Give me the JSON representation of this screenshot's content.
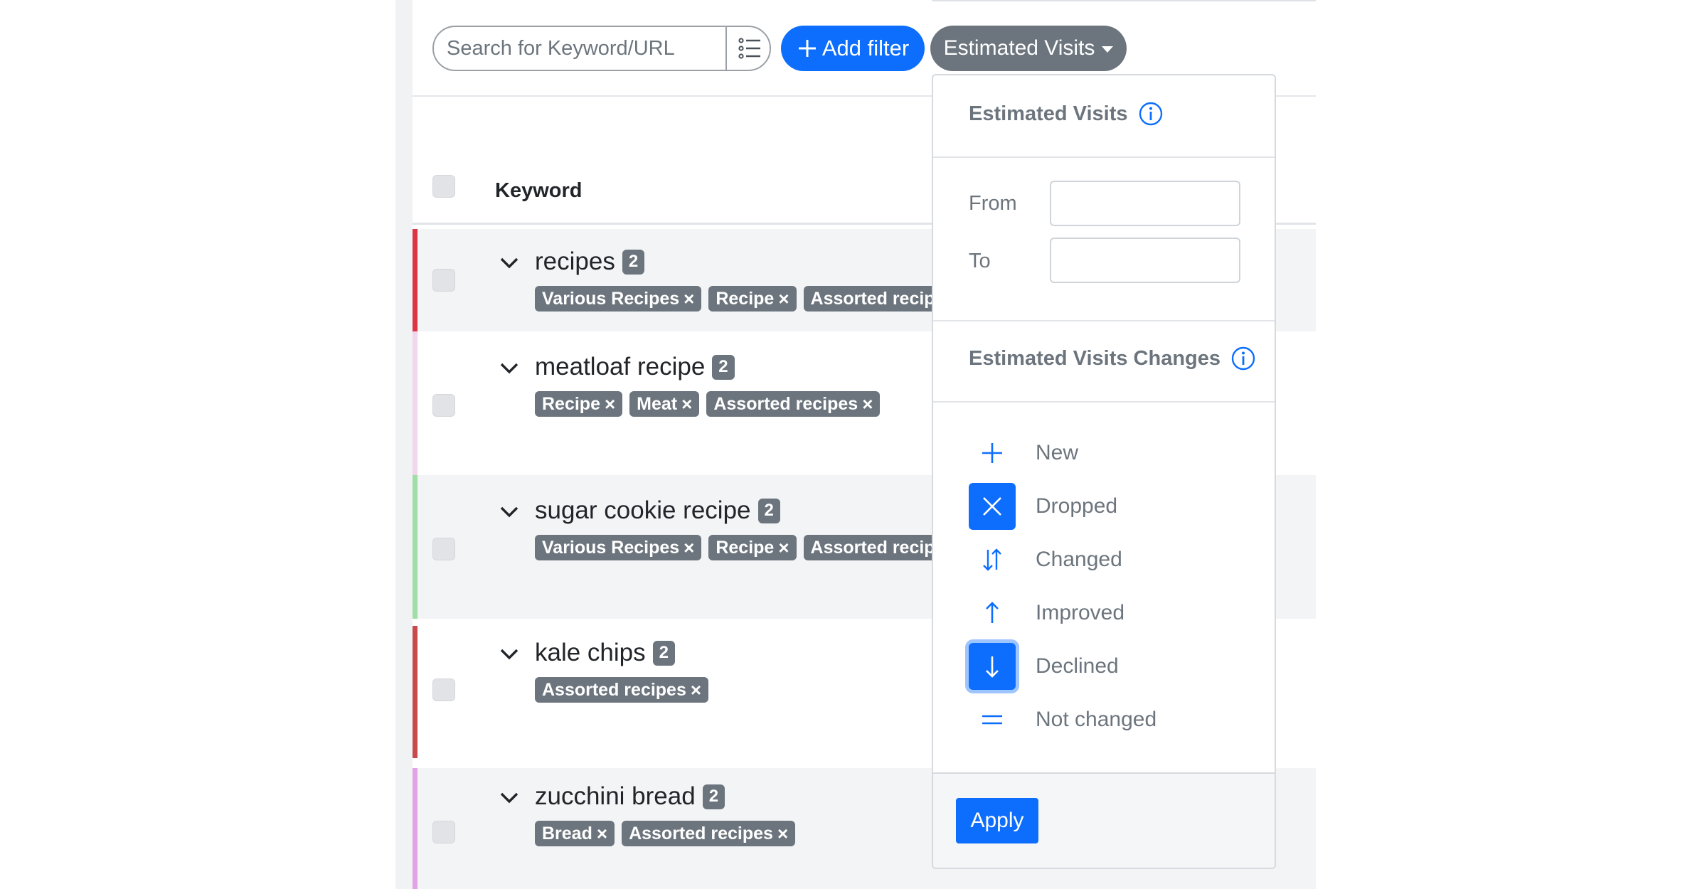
{
  "search": {
    "placeholder": "Search for Keyword/URL",
    "value": ""
  },
  "toolbar": {
    "add_filter_label": "Add filter",
    "estimated_visits_label": "Estimated Visits"
  },
  "table": {
    "header": {
      "keyword_label": "Keyword"
    },
    "rows": [
      {
        "keyword": "recipes",
        "count": "2",
        "stripe_color": "#dc3545",
        "tags": [
          "Various Recipes",
          "Recipe",
          "Assorted recipes"
        ]
      },
      {
        "keyword": "meatloaf recipe",
        "count": "2",
        "stripe_color": "#f1d6ec",
        "tags": [
          "Recipe",
          "Meat",
          "Assorted recipes"
        ]
      },
      {
        "keyword": "sugar cookie recipe",
        "count": "2",
        "stripe_color": "#9fdfa7",
        "tags": [
          "Various Recipes",
          "Recipe",
          "Assorted recipes"
        ]
      },
      {
        "keyword": "kale chips",
        "count": "2",
        "stripe_color": "#c84b4b",
        "tags": [
          "Assorted recipes"
        ]
      },
      {
        "keyword": "zucchini bread",
        "count": "2",
        "stripe_color": "#e1a3e3",
        "tags": [
          "Bread",
          "Assorted recipes"
        ]
      }
    ]
  },
  "dropdown": {
    "section1_title": "Estimated Visits",
    "from_label": "From",
    "to_label": "To",
    "from_value": "",
    "to_value": "",
    "section2_title": "Estimated Visits Changes",
    "options": [
      {
        "label": "New",
        "icon": "plus-icon",
        "selected": false
      },
      {
        "label": "Dropped",
        "icon": "x-icon",
        "selected": true
      },
      {
        "label": "Changed",
        "icon": "arrows-up-down-icon",
        "selected": false
      },
      {
        "label": "Improved",
        "icon": "arrow-up-icon",
        "selected": false
      },
      {
        "label": "Declined",
        "icon": "arrow-down-icon",
        "selected": true
      },
      {
        "label": "Not changed",
        "icon": "equals-icon",
        "selected": false
      }
    ],
    "apply_label": "Apply"
  },
  "colors": {
    "primary": "#0d6efd",
    "secondary": "#6c757d"
  }
}
